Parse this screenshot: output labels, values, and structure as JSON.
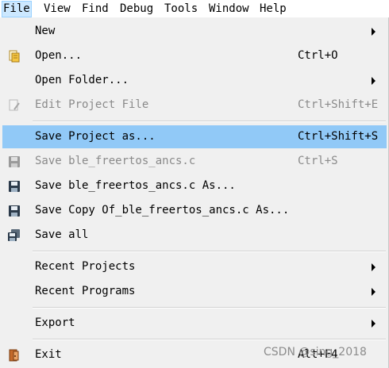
{
  "menubar": {
    "items": [
      {
        "label": "File",
        "open": true
      },
      {
        "label": "View"
      },
      {
        "label": "Find"
      },
      {
        "label": "Debug"
      },
      {
        "label": "Tools"
      },
      {
        "label": "Window"
      },
      {
        "label": "Help"
      }
    ]
  },
  "file_menu": {
    "new": {
      "label": "New",
      "submenu": true
    },
    "open": {
      "label": "Open...",
      "shortcut": "Ctrl+O",
      "icon": "open-folder-icon"
    },
    "open_folder": {
      "label": "Open Folder...",
      "submenu": true
    },
    "edit_project_file": {
      "label": "Edit Project File",
      "shortcut": "Ctrl+Shift+E",
      "enabled": false,
      "icon": "edit-document-icon"
    },
    "save_project_as": {
      "label": "Save Project as...",
      "shortcut": "Ctrl+Shift+S",
      "highlighted": true
    },
    "save": {
      "label": "Save ble_freertos_ancs.c",
      "shortcut": "Ctrl+S",
      "enabled": false,
      "icon": "floppy-disk-icon"
    },
    "save_as": {
      "label": "Save ble_freertos_ancs.c As...",
      "icon": "floppy-disk-icon"
    },
    "save_copy": {
      "label": "Save Copy Of_ble_freertos_ancs.c As...",
      "icon": "floppy-disk-icon"
    },
    "save_all": {
      "label": "Save all",
      "icon": "floppy-disks-icon"
    },
    "recent_projects": {
      "label": "Recent Projects",
      "submenu": true
    },
    "recent_programs": {
      "label": "Recent Programs",
      "submenu": true
    },
    "export": {
      "label": "Export",
      "submenu": true
    },
    "exit": {
      "label": "Exit",
      "shortcut": "Alt+F4",
      "icon": "exit-door-icon"
    }
  },
  "watermark": "CSDN @sing_2018",
  "colors": {
    "highlight": "#91c9f7",
    "menu_bg": "#f0f0f0",
    "disabled_text": "#8a8a8a"
  }
}
